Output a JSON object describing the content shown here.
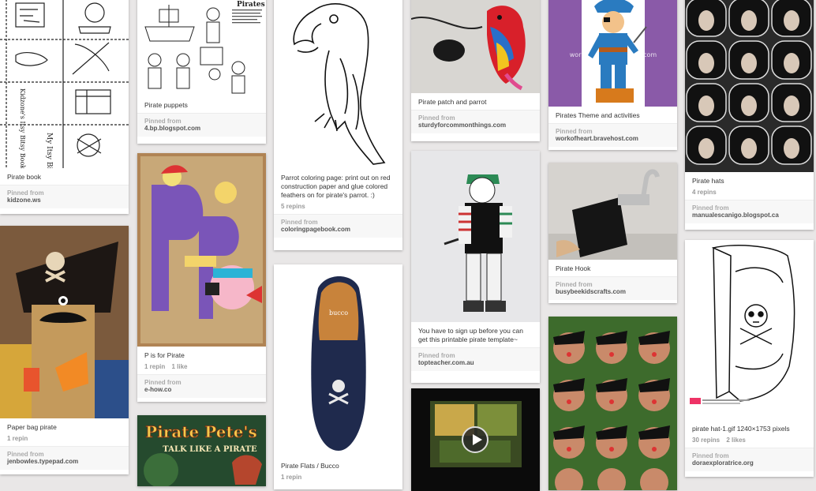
{
  "pins": [
    {
      "description": "Pirate book",
      "pinned_from": "Pinned from",
      "source": "kidzone.ws"
    },
    {
      "description": "Paper bag pirate",
      "repins": "1 repin",
      "pinned_from": "Pinned from",
      "source": "jenbowles.typepad.com"
    },
    {
      "description": "Pirate puppets",
      "pinned_from": "Pinned from",
      "source": "4.bp.blogspot.com",
      "image_caption": "Pirates"
    },
    {
      "description": "P is for Pirate",
      "repins": "1 repin",
      "likes": "1 like",
      "pinned_from": "Pinned from",
      "source": "e-how.co"
    },
    {
      "image_text": "Pirate Pete's TALK LIKE A PIRATE"
    },
    {
      "description": "Parrot coloring page: print out on red construction paper and glue colored feathers on for pirate's parrot. :)",
      "repins": "5 repins",
      "pinned_from": "Pinned from",
      "source": "coloringpagebook.com"
    },
    {
      "description": "Pirate Flats / Bucco",
      "repins": "1 repin",
      "image_text": "bucco"
    },
    {
      "description": "Pirate patch and parrot",
      "pinned_from": "Pinned from",
      "source": "sturdyforcommonthings.com"
    },
    {
      "description": "You have to sign up before you can get this printable pirate template~",
      "pinned_from": "Pinned from",
      "source": "topteacher.com.au"
    },
    {
      "video_label": "play-icon"
    },
    {
      "description": "Pirates Theme and activities",
      "pinned_from": "Pinned from",
      "source": "workofheart.bravehost.com",
      "image_text": "workofheart.bravehost.com"
    },
    {
      "description": "Pirate Hook",
      "pinned_from": "Pinned from",
      "source": "busybeekidscrafts.com"
    },
    {
      "description": "Pirate hats",
      "repins": "4 repins",
      "pinned_from": "Pinned from",
      "source": "manualescanigo.blogspot.ca"
    },
    {
      "description": "pirate hat-1.gif 1240×1753 pixels",
      "repins": "30 repins",
      "likes": "2 likes",
      "pinned_from": "Pinned from",
      "source": "doraexploratrice.org"
    }
  ],
  "colors": {
    "background": "#e9e7e7",
    "card": "#ffffff",
    "attrib_bg": "#f7f7f7"
  }
}
